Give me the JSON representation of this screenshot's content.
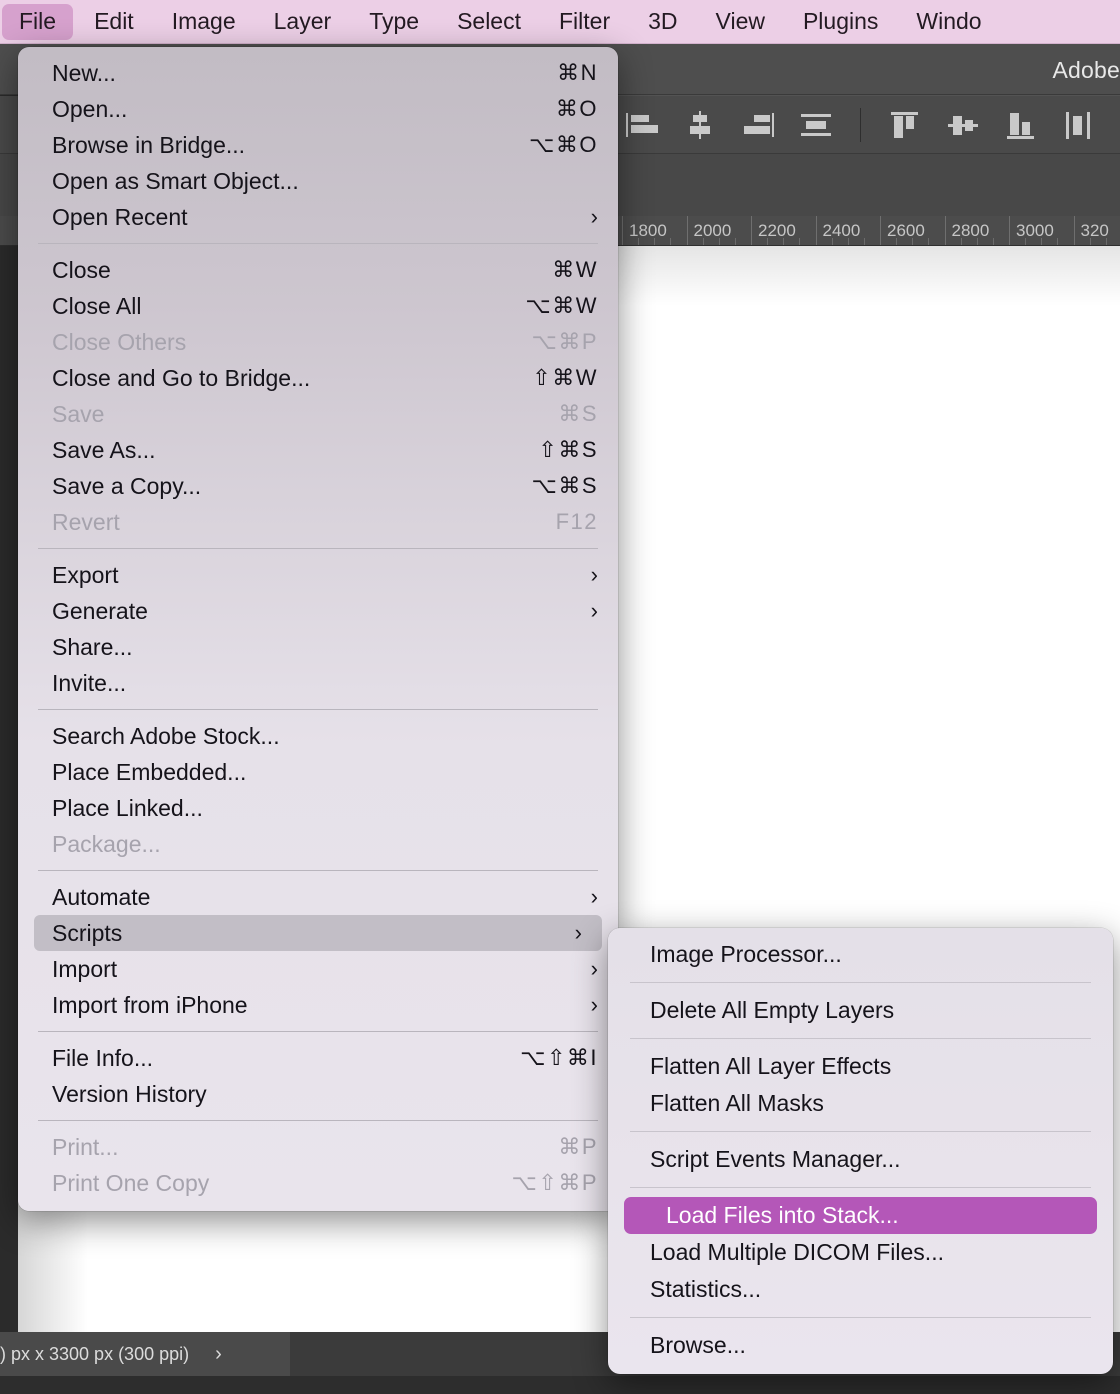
{
  "menubar": {
    "items": [
      {
        "label": "File",
        "active": true
      },
      {
        "label": "Edit",
        "active": false
      },
      {
        "label": "Image",
        "active": false
      },
      {
        "label": "Layer",
        "active": false
      },
      {
        "label": "Type",
        "active": false
      },
      {
        "label": "Select",
        "active": false
      },
      {
        "label": "Filter",
        "active": false
      },
      {
        "label": "3D",
        "active": false
      },
      {
        "label": "View",
        "active": false
      },
      {
        "label": "Plugins",
        "active": false
      },
      {
        "label": "Windo",
        "active": false
      }
    ]
  },
  "app": {
    "title": "Adobe",
    "status_text": ") px x 3300 px (300 ppi)",
    "status_chevron": "›",
    "ruler_labels": [
      "1800",
      "2000",
      "2200",
      "2400",
      "2600",
      "2800",
      "3000",
      "320"
    ]
  },
  "file_menu": {
    "rows": [
      {
        "label": "New...",
        "shortcut": "⌘N"
      },
      {
        "label": "Open...",
        "shortcut": "⌘O"
      },
      {
        "label": "Browse in Bridge...",
        "shortcut": "⌥⌘O"
      },
      {
        "label": "Open as Smart Object...",
        "shortcut": ""
      },
      {
        "label": "Open Recent",
        "shortcut": "",
        "chevron": "›"
      },
      {
        "separator": true
      },
      {
        "label": "Close",
        "shortcut": "⌘W"
      },
      {
        "label": "Close All",
        "shortcut": "⌥⌘W"
      },
      {
        "label": "Close Others",
        "shortcut": "⌥⌘P",
        "disabled": true
      },
      {
        "label": "Close and Go to Bridge...",
        "shortcut": "⇧⌘W"
      },
      {
        "label": "Save",
        "shortcut": "⌘S",
        "disabled": true
      },
      {
        "label": "Save As...",
        "shortcut": "⇧⌘S"
      },
      {
        "label": "Save a Copy...",
        "shortcut": "⌥⌘S"
      },
      {
        "label": "Revert",
        "shortcut": "F12",
        "disabled": true
      },
      {
        "separator": true
      },
      {
        "label": "Export",
        "shortcut": "",
        "chevron": "›"
      },
      {
        "label": "Generate",
        "shortcut": "",
        "chevron": "›"
      },
      {
        "label": "Share...",
        "shortcut": ""
      },
      {
        "label": "Invite...",
        "shortcut": ""
      },
      {
        "separator": true
      },
      {
        "label": "Search Adobe Stock...",
        "shortcut": ""
      },
      {
        "label": "Place Embedded...",
        "shortcut": ""
      },
      {
        "label": "Place Linked...",
        "shortcut": ""
      },
      {
        "label": "Package...",
        "shortcut": "",
        "disabled": true
      },
      {
        "separator": true
      },
      {
        "label": "Automate",
        "shortcut": "",
        "chevron": "›"
      },
      {
        "label": "Scripts",
        "shortcut": "",
        "chevron": "›",
        "highlight": "gray"
      },
      {
        "label": "Import",
        "shortcut": "",
        "chevron": "›"
      },
      {
        "label": "Import from iPhone",
        "shortcut": "",
        "chevron": "›"
      },
      {
        "separator": true
      },
      {
        "label": "File Info...",
        "shortcut": "⌥⇧⌘I"
      },
      {
        "label": "Version History",
        "shortcut": ""
      },
      {
        "separator": true
      },
      {
        "label": "Print...",
        "shortcut": "⌘P",
        "disabled": true
      },
      {
        "label": "Print One Copy",
        "shortcut": "⌥⇧⌘P",
        "disabled": true
      }
    ]
  },
  "scripts_submenu": {
    "rows": [
      {
        "label": "Image Processor...",
        "shortcut": ""
      },
      {
        "separator": true
      },
      {
        "label": "Delete All Empty Layers",
        "shortcut": ""
      },
      {
        "separator": true
      },
      {
        "label": "Flatten All Layer Effects",
        "shortcut": ""
      },
      {
        "label": "Flatten All Masks",
        "shortcut": ""
      },
      {
        "separator": true
      },
      {
        "label": "Script Events Manager...",
        "shortcut": ""
      },
      {
        "separator": true
      },
      {
        "label": "Load Files into Stack...",
        "shortcut": "",
        "highlight": "purple"
      },
      {
        "label": "Load Multiple DICOM Files...",
        "shortcut": ""
      },
      {
        "label": "Statistics...",
        "shortcut": ""
      },
      {
        "separator": true
      },
      {
        "label": "Browse...",
        "shortcut": ""
      }
    ]
  },
  "colors": {
    "menubar_bg": "#eccfe6",
    "menubar_active": "#d6a1cd",
    "highlight_purple": "#b457b8",
    "highlight_gray": "#c2bec6",
    "menu_bg": "#e6e1e9",
    "app_bg": "#535353"
  }
}
